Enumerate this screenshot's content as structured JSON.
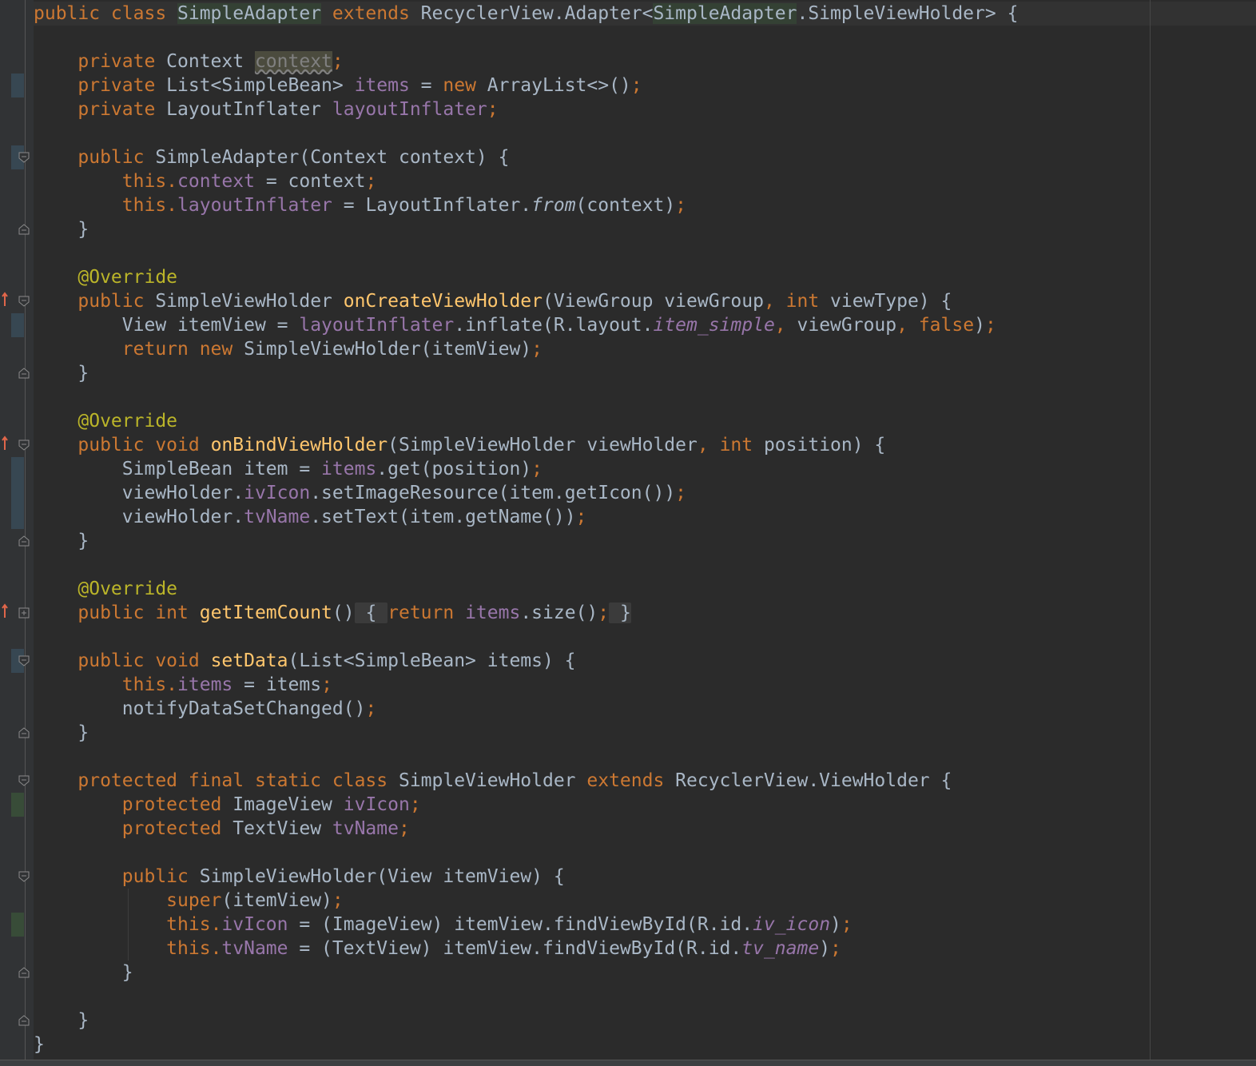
{
  "editor": {
    "lines": [
      [
        [
          "kw",
          "public class "
        ],
        [
          "caret",
          ""
        ],
        [
          "hl",
          "SimpleAdapter"
        ],
        [
          "kw",
          " extends "
        ],
        [
          "",
          "RecyclerView.Adapter<"
        ],
        [
          "hl",
          "SimpleAdapter"
        ],
        [
          "",
          ".SimpleViewHolder> {"
        ]
      ],
      [],
      [
        [
          "",
          "    "
        ],
        [
          "kw",
          "private "
        ],
        [
          "",
          "Context "
        ],
        [
          "unused",
          "context"
        ],
        [
          "punct",
          ";"
        ]
      ],
      [
        [
          "",
          "    "
        ],
        [
          "kw",
          "private "
        ],
        [
          "",
          "List<SimpleBean> "
        ],
        [
          "field",
          "items"
        ],
        [
          "",
          " = "
        ],
        [
          "kw",
          "new "
        ],
        [
          "",
          "ArrayList<>()"
        ],
        [
          "punct",
          ";"
        ]
      ],
      [
        [
          "",
          "    "
        ],
        [
          "kw",
          "private "
        ],
        [
          "",
          "LayoutInflater "
        ],
        [
          "field",
          "layoutInflater"
        ],
        [
          "punct",
          ";"
        ]
      ],
      [],
      [
        [
          "",
          "    "
        ],
        [
          "kw",
          "public "
        ],
        [
          "",
          "SimpleAdapter(Context context) {"
        ]
      ],
      [
        [
          "",
          "        "
        ],
        [
          "kw",
          "this"
        ],
        [
          "punct",
          "."
        ],
        [
          "field",
          "context"
        ],
        [
          "",
          " = context"
        ],
        [
          "punct",
          ";"
        ]
      ],
      [
        [
          "",
          "        "
        ],
        [
          "kw",
          "this"
        ],
        [
          "punct",
          "."
        ],
        [
          "field",
          "layoutInflater"
        ],
        [
          "",
          " = LayoutInflater."
        ],
        [
          "static",
          "from"
        ],
        [
          "",
          "(context)"
        ],
        [
          "punct",
          ";"
        ]
      ],
      [
        [
          "",
          "    }"
        ]
      ],
      [],
      [
        [
          "",
          "    "
        ],
        [
          "ann",
          "@Override"
        ]
      ],
      [
        [
          "",
          "    "
        ],
        [
          "kw",
          "public "
        ],
        [
          "",
          "SimpleViewHolder "
        ],
        [
          "fn",
          "onCreateViewHolder"
        ],
        [
          "",
          "(ViewGroup viewGroup"
        ],
        [
          "punct",
          ", "
        ],
        [
          "kw",
          "int "
        ],
        [
          "",
          "viewType) {"
        ]
      ],
      [
        [
          "",
          "        View itemView = "
        ],
        [
          "field",
          "layoutInflater"
        ],
        [
          "",
          ".inflate(R.layout."
        ],
        [
          "ifield",
          "item_simple"
        ],
        [
          "punct",
          ", "
        ],
        [
          "",
          "viewGroup"
        ],
        [
          "punct",
          ", "
        ],
        [
          "kw",
          "false"
        ],
        [
          "",
          ")"
        ],
        [
          "punct",
          ";"
        ]
      ],
      [
        [
          "",
          "        "
        ],
        [
          "kw",
          "return new "
        ],
        [
          "",
          "SimpleViewHolder(itemView)"
        ],
        [
          "punct",
          ";"
        ]
      ],
      [
        [
          "",
          "    }"
        ]
      ],
      [],
      [
        [
          "",
          "    "
        ],
        [
          "ann",
          "@Override"
        ]
      ],
      [
        [
          "",
          "    "
        ],
        [
          "kw",
          "public void "
        ],
        [
          "fn",
          "onBindViewHolder"
        ],
        [
          "",
          "(SimpleViewHolder viewHolder"
        ],
        [
          "punct",
          ", "
        ],
        [
          "kw",
          "int "
        ],
        [
          "",
          "position) {"
        ]
      ],
      [
        [
          "",
          "        SimpleBean item = "
        ],
        [
          "field",
          "items"
        ],
        [
          "",
          ".get(position)"
        ],
        [
          "punct",
          ";"
        ]
      ],
      [
        [
          "",
          "        viewHolder."
        ],
        [
          "field",
          "ivIcon"
        ],
        [
          "",
          ".setImageResource(item.getIcon())"
        ],
        [
          "punct",
          ";"
        ]
      ],
      [
        [
          "",
          "        viewHolder."
        ],
        [
          "field",
          "tvName"
        ],
        [
          "",
          ".setText(item.getName())"
        ],
        [
          "punct",
          ";"
        ]
      ],
      [
        [
          "",
          "    }"
        ]
      ],
      [],
      [
        [
          "",
          "    "
        ],
        [
          "ann",
          "@Override"
        ]
      ],
      [
        [
          "",
          "    "
        ],
        [
          "kw",
          "public int "
        ],
        [
          "fn",
          "getItemCount"
        ],
        [
          "",
          "()"
        ],
        [
          "fold",
          " { "
        ],
        [
          "kw",
          "return "
        ],
        [
          "field",
          "items"
        ],
        [
          "",
          ".size()"
        ],
        [
          "punct",
          ";"
        ],
        [
          "fold",
          " }"
        ]
      ],
      [],
      [
        [
          "",
          "    "
        ],
        [
          "kw",
          "public void "
        ],
        [
          "fn",
          "setData"
        ],
        [
          "",
          "(List<SimpleBean> items) {"
        ]
      ],
      [
        [
          "",
          "        "
        ],
        [
          "kw",
          "this"
        ],
        [
          "punct",
          "."
        ],
        [
          "field",
          "items"
        ],
        [
          "",
          " = items"
        ],
        [
          "punct",
          ";"
        ]
      ],
      [
        [
          "",
          "        notifyDataSetChanged()"
        ],
        [
          "punct",
          ";"
        ]
      ],
      [
        [
          "",
          "    }"
        ]
      ],
      [],
      [
        [
          "",
          "    "
        ],
        [
          "kw",
          "protected final static class "
        ],
        [
          "",
          "SimpleViewHolder "
        ],
        [
          "kw",
          "extends "
        ],
        [
          "",
          "RecyclerView.ViewHolder {"
        ]
      ],
      [
        [
          "",
          "        "
        ],
        [
          "kw",
          "protected "
        ],
        [
          "",
          "ImageView "
        ],
        [
          "field",
          "ivIcon"
        ],
        [
          "punct",
          ";"
        ]
      ],
      [
        [
          "",
          "        "
        ],
        [
          "kw",
          "protected "
        ],
        [
          "",
          "TextView "
        ],
        [
          "field",
          "tvName"
        ],
        [
          "punct",
          ";"
        ]
      ],
      [],
      [
        [
          "",
          "        "
        ],
        [
          "kw",
          "public "
        ],
        [
          "",
          "SimpleViewHolder(View itemView) {"
        ]
      ],
      [
        [
          "",
          "            "
        ],
        [
          "kw",
          "super"
        ],
        [
          "",
          "(itemView)"
        ],
        [
          "punct",
          ";"
        ]
      ],
      [
        [
          "",
          "            "
        ],
        [
          "kw",
          "this"
        ],
        [
          "punct",
          "."
        ],
        [
          "field",
          "ivIcon"
        ],
        [
          "",
          " = (ImageView) itemView.findViewById(R.id."
        ],
        [
          "ifield",
          "iv_icon"
        ],
        [
          "",
          ")"
        ],
        [
          "punct",
          ";"
        ]
      ],
      [
        [
          "",
          "            "
        ],
        [
          "kw",
          "this"
        ],
        [
          "punct",
          "."
        ],
        [
          "field",
          "tvName"
        ],
        [
          "",
          " = (TextView) itemView.findViewById(R.id."
        ],
        [
          "ifield",
          "tv_name"
        ],
        [
          "",
          ")"
        ],
        [
          "punct",
          ";"
        ]
      ],
      [
        [
          "",
          "        }"
        ]
      ],
      [],
      [
        [
          "",
          "    }"
        ]
      ],
      [
        [
          "",
          "}"
        ]
      ]
    ]
  },
  "colors": {
    "background": "#2b2b2b",
    "gutter": "#313335",
    "keyword": "#cc7832",
    "field": "#9876aa",
    "method": "#ffc66d",
    "annotation": "#bbb529",
    "text": "#a9b7c6"
  },
  "gutter_icons": [
    "fold-start-icon",
    "fold-end-icon",
    "fold-expand-icon",
    "override-arrow-icon"
  ]
}
